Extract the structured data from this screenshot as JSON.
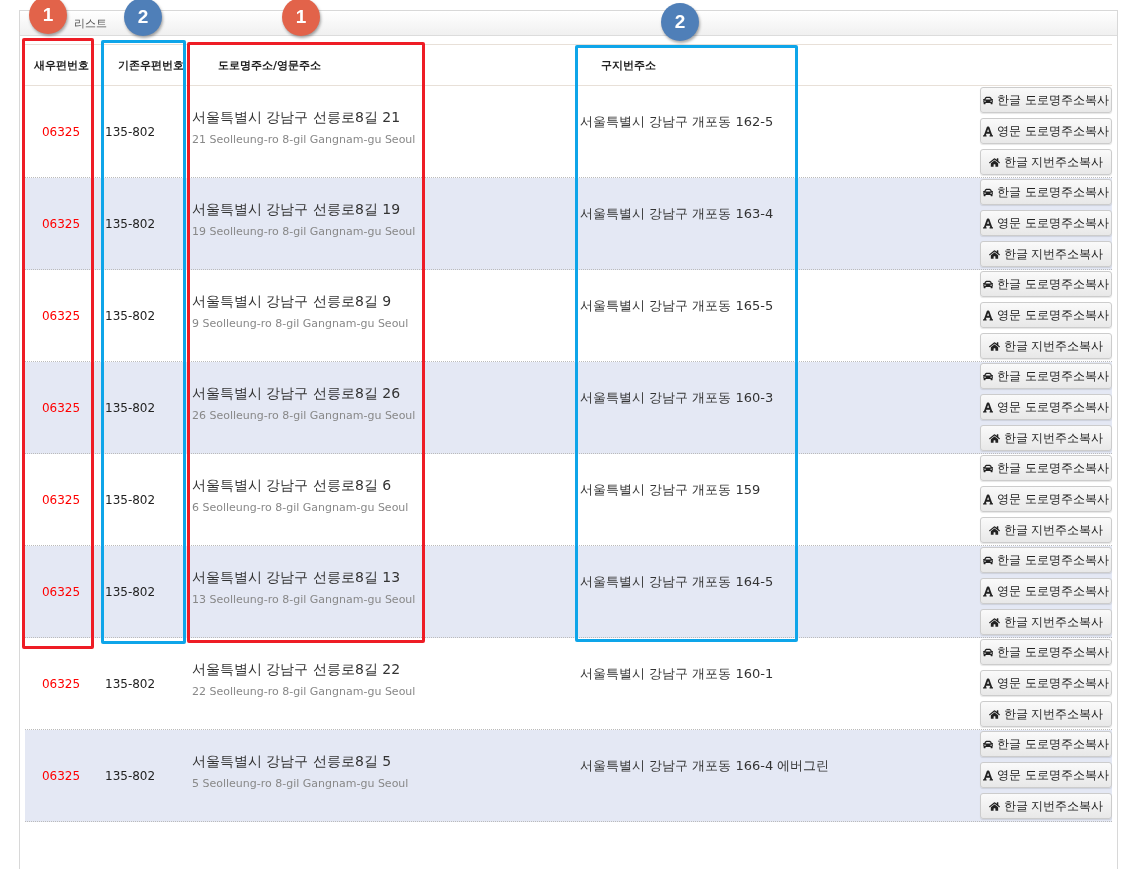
{
  "panel": {
    "title": "리스트"
  },
  "columns": [
    "새우편번호",
    "기존우편번호",
    "도로명주소/영문주소",
    "구지번주소"
  ],
  "rows": [
    {
      "new_zip": "06325",
      "old_zip": "135-802",
      "road_address": "서울특별시 강남구 선릉로8길 21",
      "english_address": "21 Seolleung-ro 8-gil Gangnam-gu Seoul",
      "lot_address": "서울특별시 강남구 개포동 162-5",
      "buttons": [
        {
          "kind": "car",
          "label": "한글 도로명주소복사"
        },
        {
          "kind": "font",
          "label": "영문 도로명주소복사"
        },
        {
          "kind": "home",
          "label": "한글 지번주소복사"
        }
      ]
    },
    {
      "new_zip": "06325",
      "old_zip": "135-802",
      "road_address": "서울특별시 강남구 선릉로8길 19",
      "english_address": "19 Seolleung-ro 8-gil Gangnam-gu Seoul",
      "lot_address": "서울특별시 강남구 개포동 163-4",
      "buttons": [
        {
          "kind": "car",
          "label": "한글 도로명주소복사"
        },
        {
          "kind": "font",
          "label": "영문 도로명주소복사"
        },
        {
          "kind": "home",
          "label": "한글 지번주소복사"
        }
      ]
    },
    {
      "new_zip": "06325",
      "old_zip": "135-802",
      "road_address": "서울특별시 강남구 선릉로8길 9",
      "english_address": "9 Seolleung-ro 8-gil Gangnam-gu Seoul",
      "lot_address": "서울특별시 강남구 개포동 165-5",
      "buttons": [
        {
          "kind": "car",
          "label": "한글 도로명주소복사"
        },
        {
          "kind": "font",
          "label": "영문 도로명주소복사"
        },
        {
          "kind": "home",
          "label": "한글 지번주소복사"
        }
      ]
    },
    {
      "new_zip": "06325",
      "old_zip": "135-802",
      "road_address": "서울특별시 강남구 선릉로8길 26",
      "english_address": "26 Seolleung-ro 8-gil Gangnam-gu Seoul",
      "lot_address": "서울특별시 강남구 개포동 160-3",
      "buttons": [
        {
          "kind": "car",
          "label": "한글 도로명주소복사"
        },
        {
          "kind": "font",
          "label": "영문 도로명주소복사"
        },
        {
          "kind": "home",
          "label": "한글 지번주소복사"
        }
      ]
    },
    {
      "new_zip": "06325",
      "old_zip": "135-802",
      "road_address": "서울특별시 강남구 선릉로8길 6",
      "english_address": "6 Seolleung-ro 8-gil Gangnam-gu Seoul",
      "lot_address": "서울특별시 강남구 개포동 159",
      "buttons": [
        {
          "kind": "car",
          "label": "한글 도로명주소복사"
        },
        {
          "kind": "font",
          "label": "영문 도로명주소복사"
        },
        {
          "kind": "home",
          "label": "한글 지번주소복사"
        }
      ]
    },
    {
      "new_zip": "06325",
      "old_zip": "135-802",
      "road_address": "서울특별시 강남구 선릉로8길 13",
      "english_address": "13 Seolleung-ro 8-gil Gangnam-gu Seoul",
      "lot_address": "서울특별시 강남구 개포동 164-5",
      "buttons": [
        {
          "kind": "car",
          "label": "한글 도로명주소복사"
        },
        {
          "kind": "font",
          "label": "영문 도로명주소복사"
        },
        {
          "kind": "home",
          "label": "한글 지번주소복사"
        }
      ]
    },
    {
      "new_zip": "06325",
      "old_zip": "135-802",
      "road_address": "서울특별시 강남구 선릉로8길 22",
      "english_address": "22 Seolleung-ro 8-gil Gangnam-gu Seoul",
      "lot_address": "서울특별시 강남구 개포동 160-1",
      "buttons": [
        {
          "kind": "car",
          "label": "한글 도로명주소복사"
        },
        {
          "kind": "font",
          "label": "영문 도로명주소복사"
        },
        {
          "kind": "home",
          "label": "한글 지번주소복사"
        }
      ]
    },
    {
      "new_zip": "06325",
      "old_zip": "135-802",
      "road_address": "서울특별시 강남구 선릉로8길 5",
      "english_address": "5 Seolleung-ro 8-gil Gangnam-gu Seoul",
      "lot_address": "서울특별시 강남구 개포동 166-4 에버그린",
      "buttons": [
        {
          "kind": "car",
          "label": "한글 도로명주소복사"
        },
        {
          "kind": "font",
          "label": "영문 도로명주소복사"
        },
        {
          "kind": "home",
          "label": "한글 지번주소복사"
        }
      ]
    }
  ],
  "annotations": [
    {
      "label": "1",
      "kind": "red"
    },
    {
      "label": "2",
      "kind": "blue"
    },
    {
      "label": "1",
      "kind": "red"
    },
    {
      "label": "2",
      "kind": "blue"
    }
  ]
}
